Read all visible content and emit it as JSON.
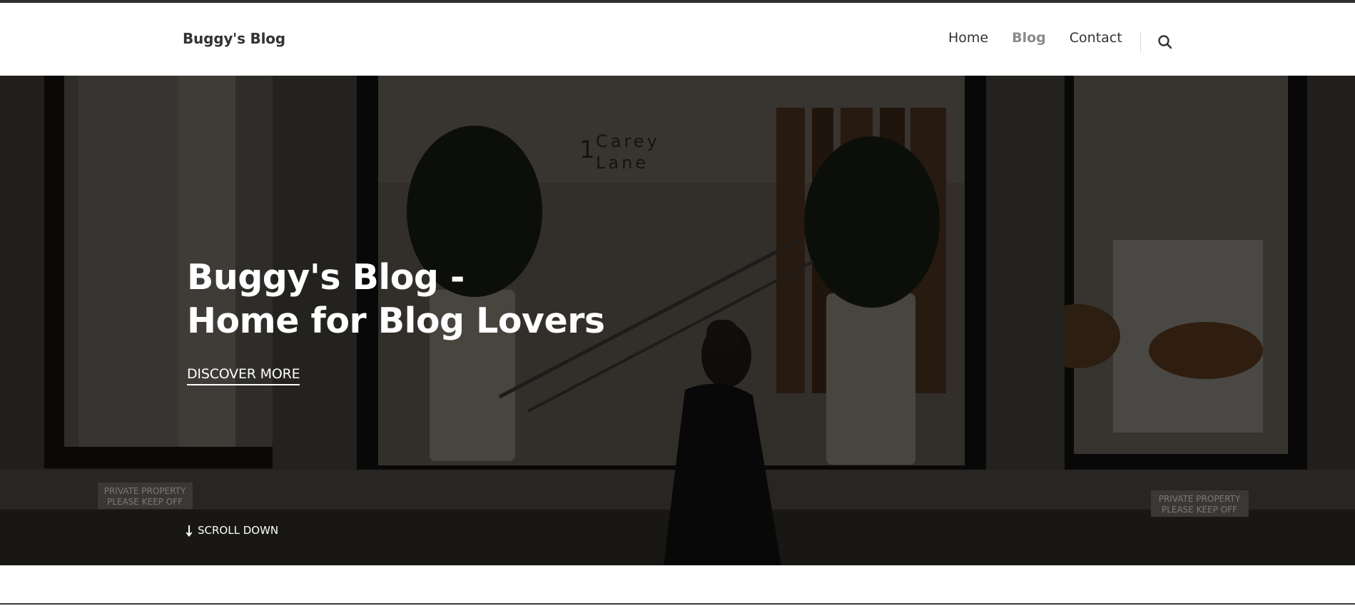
{
  "header": {
    "brand": "Buggy's Blog",
    "nav": [
      {
        "label": "Home",
        "active": false
      },
      {
        "label": "Blog",
        "active": true
      },
      {
        "label": "Contact",
        "active": false
      }
    ],
    "search_icon": "search-icon"
  },
  "hero": {
    "title_line1": "Buggy's Blog -",
    "title_line2": "Home for Blog Lovers",
    "cta_label": "DISCOVER MORE",
    "scroll_label": "SCROLL DOWN",
    "scroll_icon": "arrow-down-icon",
    "sign_left": [
      "PRIVATE PROPERTY",
      "PLEASE KEEP OFF"
    ],
    "sign_right": [
      "PRIVATE PROPERTY",
      "PLEASE KEEP OFF"
    ],
    "window_lettering": [
      "1",
      "Carey",
      "Lane"
    ]
  },
  "colors": {
    "text_dark": "#333333",
    "nav_active": "#8a8a8a",
    "overlay": "#000000"
  }
}
